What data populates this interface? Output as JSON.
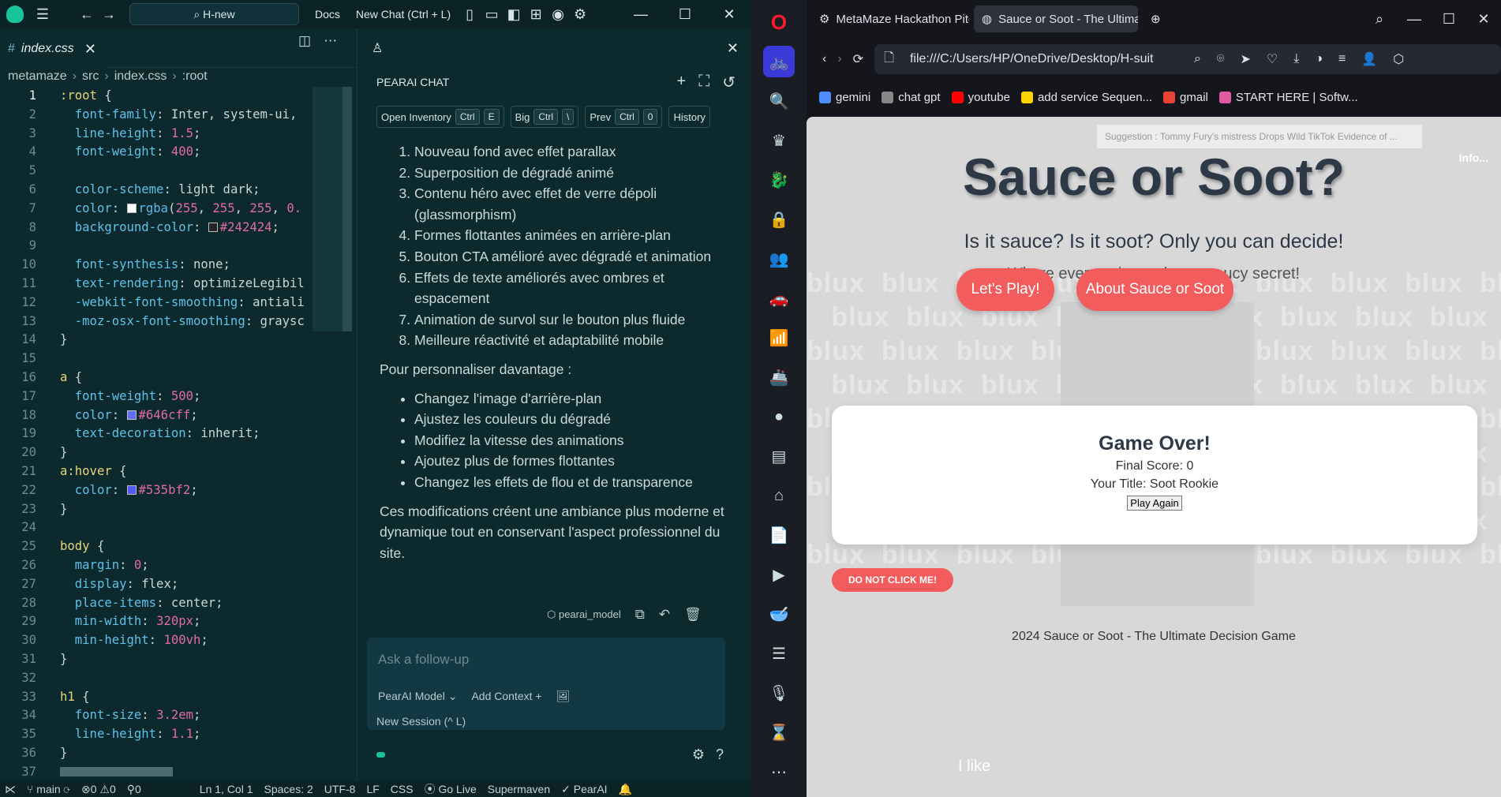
{
  "ide": {
    "search": "H-new",
    "docs": "Docs",
    "new_chat": "New Chat (Ctrl + L)",
    "tab": "index.css",
    "breadcrumb": [
      "metamaze",
      "src",
      "index.css",
      ":root"
    ],
    "code": [
      [
        {
          "c": "t-sel",
          "t": ":root"
        },
        {
          "t": " {"
        }
      ],
      [
        {
          "t": "  "
        },
        {
          "c": "t-prop",
          "t": "font-family"
        },
        {
          "t": ": Inter, system-ui,"
        }
      ],
      [
        {
          "t": "  "
        },
        {
          "c": "t-prop",
          "t": "line-height"
        },
        {
          "t": ": "
        },
        {
          "c": "t-num",
          "t": "1.5"
        },
        {
          "t": ";"
        }
      ],
      [
        {
          "t": "  "
        },
        {
          "c": "t-prop",
          "t": "font-weight"
        },
        {
          "t": ": "
        },
        {
          "c": "t-num",
          "t": "400"
        },
        {
          "t": ";"
        }
      ],
      [
        {
          "t": ""
        }
      ],
      [
        {
          "t": "  "
        },
        {
          "c": "t-prop",
          "t": "color-scheme"
        },
        {
          "t": ": light dark;"
        }
      ],
      [
        {
          "t": "  "
        },
        {
          "c": "t-prop",
          "t": "color"
        },
        {
          "t": ": "
        },
        {
          "sw": "#ffffff"
        },
        {
          "c": "t-kw",
          "t": "rgba"
        },
        {
          "t": "("
        },
        {
          "c": "t-num",
          "t": "255"
        },
        {
          "t": ", "
        },
        {
          "c": "t-num",
          "t": "255"
        },
        {
          "t": ", "
        },
        {
          "c": "t-num",
          "t": "255"
        },
        {
          "t": ", "
        },
        {
          "c": "t-num",
          "t": "0."
        }
      ],
      [
        {
          "t": "  "
        },
        {
          "c": "t-prop",
          "t": "background-color"
        },
        {
          "t": ": "
        },
        {
          "sw": "#242424"
        },
        {
          "c": "t-col",
          "t": "#242424"
        },
        {
          "t": ";"
        }
      ],
      [
        {
          "t": ""
        }
      ],
      [
        {
          "t": "  "
        },
        {
          "c": "t-prop",
          "t": "font-synthesis"
        },
        {
          "t": ": none;"
        }
      ],
      [
        {
          "t": "  "
        },
        {
          "c": "t-prop",
          "t": "text-rendering"
        },
        {
          "t": ": optimizeLegibil"
        }
      ],
      [
        {
          "t": "  "
        },
        {
          "c": "t-prop",
          "t": "-webkit-font-smoothing"
        },
        {
          "t": ": antiali"
        }
      ],
      [
        {
          "t": "  "
        },
        {
          "c": "t-prop",
          "t": "-moz-osx-font-smoothing"
        },
        {
          "t": ": graysc"
        }
      ],
      [
        {
          "t": "}"
        }
      ],
      [
        {
          "t": ""
        }
      ],
      [
        {
          "c": "t-sel",
          "t": "a"
        },
        {
          "t": " {"
        }
      ],
      [
        {
          "t": "  "
        },
        {
          "c": "t-prop",
          "t": "font-weight"
        },
        {
          "t": ": "
        },
        {
          "c": "t-num",
          "t": "500"
        },
        {
          "t": ";"
        }
      ],
      [
        {
          "t": "  "
        },
        {
          "c": "t-prop",
          "t": "color"
        },
        {
          "t": ": "
        },
        {
          "sw": "#646cff"
        },
        {
          "c": "t-col",
          "t": "#646cff"
        },
        {
          "t": ";"
        }
      ],
      [
        {
          "t": "  "
        },
        {
          "c": "t-prop",
          "t": "text-decoration"
        },
        {
          "t": ": inherit;"
        }
      ],
      [
        {
          "t": "}"
        }
      ],
      [
        {
          "c": "t-sel",
          "t": "a:hover"
        },
        {
          "t": " {"
        }
      ],
      [
        {
          "t": "  "
        },
        {
          "c": "t-prop",
          "t": "color"
        },
        {
          "t": ": "
        },
        {
          "sw": "#535bf2"
        },
        {
          "c": "t-col",
          "t": "#535bf2"
        },
        {
          "t": ";"
        }
      ],
      [
        {
          "t": "}"
        }
      ],
      [
        {
          "t": ""
        }
      ],
      [
        {
          "c": "t-sel",
          "t": "body"
        },
        {
          "t": " {"
        }
      ],
      [
        {
          "t": "  "
        },
        {
          "c": "t-prop",
          "t": "margin"
        },
        {
          "t": ": "
        },
        {
          "c": "t-num",
          "t": "0"
        },
        {
          "t": ";"
        }
      ],
      [
        {
          "t": "  "
        },
        {
          "c": "t-prop",
          "t": "display"
        },
        {
          "t": ": flex;"
        }
      ],
      [
        {
          "t": "  "
        },
        {
          "c": "t-prop",
          "t": "place-items"
        },
        {
          "t": ": center;"
        }
      ],
      [
        {
          "t": "  "
        },
        {
          "c": "t-prop",
          "t": "min-width"
        },
        {
          "t": ": "
        },
        {
          "c": "t-num",
          "t": "320px"
        },
        {
          "t": ";"
        }
      ],
      [
        {
          "t": "  "
        },
        {
          "c": "t-prop",
          "t": "min-height"
        },
        {
          "t": ": "
        },
        {
          "c": "t-num",
          "t": "100vh"
        },
        {
          "t": ";"
        }
      ],
      [
        {
          "t": "}"
        }
      ],
      [
        {
          "t": ""
        }
      ],
      [
        {
          "c": "t-sel",
          "t": "h1"
        },
        {
          "t": " {"
        }
      ],
      [
        {
          "t": "  "
        },
        {
          "c": "t-prop",
          "t": "font-size"
        },
        {
          "t": ": "
        },
        {
          "c": "t-num",
          "t": "3.2em"
        },
        {
          "t": ";"
        }
      ],
      [
        {
          "t": "  "
        },
        {
          "c": "t-prop",
          "t": "line-height"
        },
        {
          "t": ": "
        },
        {
          "c": "t-num",
          "t": "1.1"
        },
        {
          "t": ";"
        }
      ],
      [
        {
          "t": "}"
        }
      ],
      [
        {
          "t": ""
        }
      ]
    ],
    "chat": {
      "title": "PEARAI CHAT",
      "chips": [
        {
          "label": "Open Inventory",
          "keys": [
            "Ctrl",
            "E"
          ]
        },
        {
          "label": "Big",
          "keys": [
            "Ctrl",
            "\\"
          ]
        },
        {
          "label": "Prev",
          "keys": [
            "Ctrl",
            "0"
          ]
        },
        {
          "label": "History",
          "keys": []
        }
      ],
      "ol": [
        "Nouveau fond avec effet parallax",
        "Superposition de dégradé animé",
        "Contenu héro avec effet de verre dépoli (glassmorphism)",
        "Formes flottantes animées en arrière-plan",
        "Bouton CTA amélioré avec dégradé et animation",
        "Effets de texte améliorés avec ombres et espacement",
        "Animation de survol sur le bouton plus fluide",
        "Meilleure réactivité et adaptabilité mobile"
      ],
      "p1": "Pour personnaliser davantage :",
      "ul": [
        "Changez l'image d'arrière-plan",
        "Ajustez les couleurs du dégradé",
        "Modifiez la vitesse des animations",
        "Ajoutez plus de formes flottantes",
        "Changez les effets de flou et de transparence"
      ],
      "p2": "Ces modifications créent une ambiance plus moderne et dynamique tout en conservant l'aspect professionnel du site.",
      "model": "pearai_model",
      "placeholder": "Ask a follow-up",
      "model_select": "PearAI Model",
      "add_context": "Add Context",
      "new_session": "New Session (^ L)"
    },
    "status": {
      "branch": "main",
      "errors": "0",
      "warnings": "0",
      "ports": "0",
      "pos": "Ln 1, Col 1",
      "spaces": "Spaces: 2",
      "enc": "UTF-8",
      "eol": "LF",
      "lang": "CSS",
      "live": "Go Live",
      "sm": "Supermaven",
      "pearai": "PearAI"
    }
  },
  "browser": {
    "tabs": [
      "MetaMaze Hackathon Pitc",
      "Sauce or Soot - The Ultima"
    ],
    "url": "file:///C:/Users/HP/OneDrive/Desktop/H-suit",
    "bookmarks": [
      {
        "label": "gemini",
        "color": "#4d8bff"
      },
      {
        "label": "chat gpt",
        "color": "#888888"
      },
      {
        "label": "youtube",
        "color": "#ff0000"
      },
      {
        "label": "add service Sequen...",
        "color": "#ffd400"
      },
      {
        "label": "gmail",
        "color": "#ea4335"
      },
      {
        "label": "START HERE | Softw...",
        "color": "#e05aa0"
      }
    ],
    "page": {
      "suggestion": "Suggestion : Tommy Fury's mistress Drops Wild TikTok Evidence of ...",
      "info": "Info...",
      "title": "Sauce or Soot?",
      "sub1": "Is it sauce? Is it soot? Only you can decide!",
      "sub2": "Where every suitcase has a saucy secret!",
      "btn_play": "Let's Play!",
      "btn_about": "About Sauce or Soot",
      "game_over": "Game Over!",
      "final_score": "Final Score: 0",
      "your_title": "Your Title: Soot Rookie",
      "play_again": "Play Again",
      "dnc": "DO NOT CLICK ME!",
      "footer": "2024 Sauce or Soot - The Ultimate Decision Game",
      "watermark": "blux",
      "ilike": "I like"
    }
  }
}
